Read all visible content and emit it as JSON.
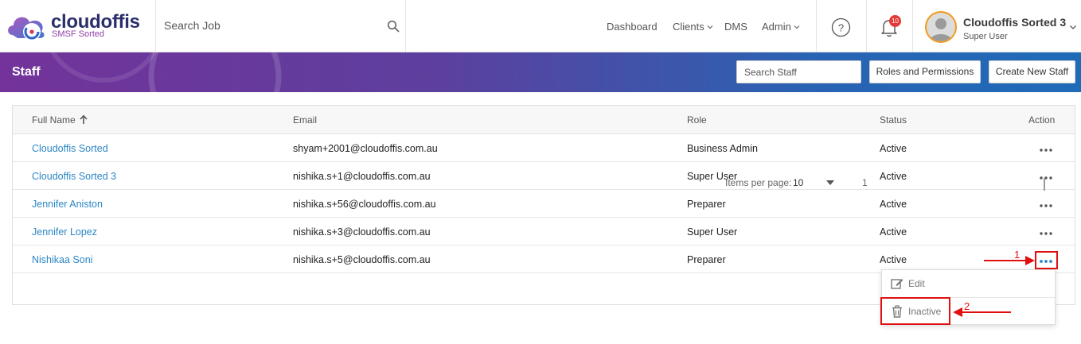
{
  "app": {
    "logo_title": "cloudoffis",
    "logo_subtitle": "SMSF Sorted"
  },
  "header": {
    "search_job": "Search Job",
    "nav": {
      "dashboard": "Dashboard",
      "clients": "Clients",
      "dms": "DMS",
      "admin": "Admin"
    },
    "notification_count": "10",
    "user": {
      "name": "Cloudoffis Sorted 3",
      "role": "Super User"
    }
  },
  "banner": {
    "title": "Staff",
    "search_placeholder": "Search Staff",
    "roles_button": "Roles and Permissions",
    "create_button": "Create New Staff"
  },
  "table": {
    "columns": {
      "name": "Full Name",
      "email": "Email",
      "role": "Role",
      "status": "Status",
      "action": "Action"
    },
    "rows": [
      {
        "name": "Cloudoffis Sorted",
        "email": "shyam+2001@cloudoffis.com.au",
        "role": "Business Admin",
        "status": "Active"
      },
      {
        "name": "Cloudoffis Sorted 3",
        "email": "nishika.s+1@cloudoffis.com.au",
        "role": "Super User",
        "status": "Active"
      },
      {
        "name": "Jennifer Aniston",
        "email": "nishika.s+56@cloudoffis.com.au",
        "role": "Preparer",
        "status": "Active"
      },
      {
        "name": "Jennifer Lopez",
        "email": "nishika.s+3@cloudoffis.com.au",
        "role": "Super User",
        "status": "Active"
      },
      {
        "name": "Nishikaa Soni",
        "email": "nishika.s+5@cloudoffis.com.au",
        "role": "Preparer",
        "status": "Active"
      }
    ]
  },
  "pagination": {
    "items_per_page_label": "Items per page:",
    "items_per_page_value": "10",
    "range_partial": "1"
  },
  "action_menu": {
    "edit": "Edit",
    "inactive": "Inactive"
  },
  "annotations": {
    "step1": "1",
    "step2": "2",
    "color": "#e01010"
  },
  "colors": {
    "link": "#2b86c5",
    "banner_start": "#73339a",
    "banner_end": "#1f6bb8",
    "badge": "#e53935",
    "avatar_ring": "#f39a1e"
  }
}
